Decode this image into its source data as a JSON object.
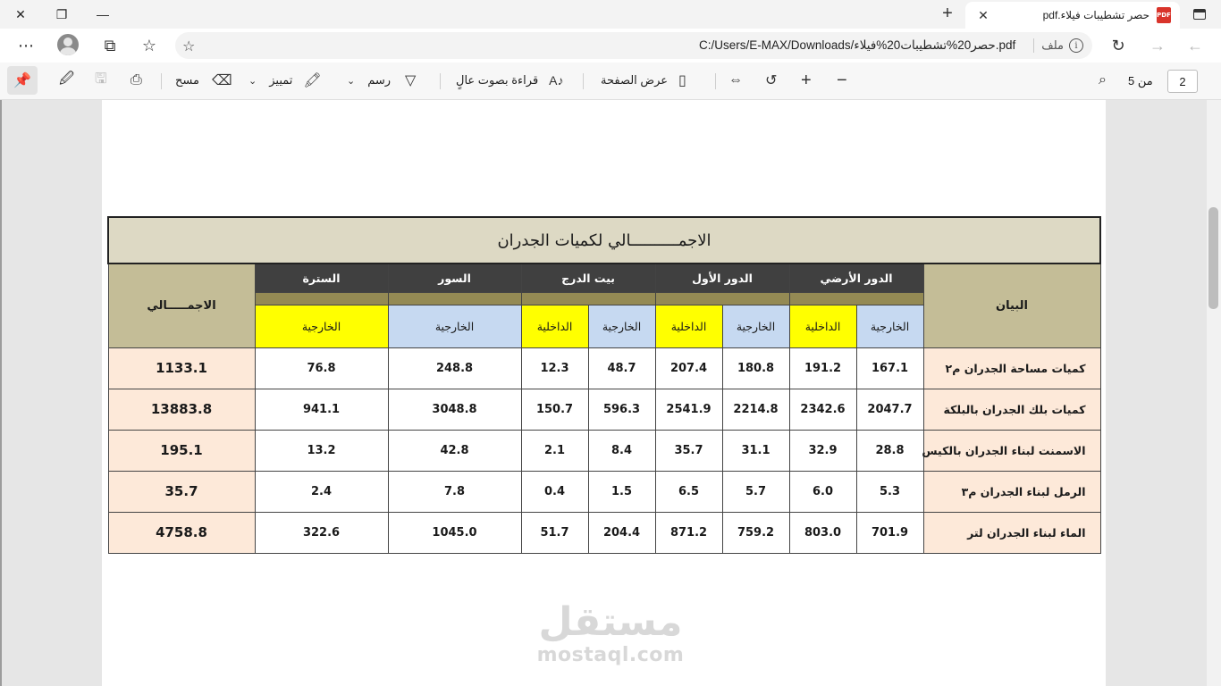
{
  "browser": {
    "tab_title": "حصر تشطيبات فيلاء.pdf",
    "pdf_icon_label": "PDF",
    "address_label": "ملف",
    "url": "C:/Users/E-MAX/Downloads/حصر20%تشطيبات20%فيلاء.pdf"
  },
  "pdf_toolbar": {
    "page_current": "2",
    "page_of": "من 5",
    "fit_page_label": "عرض الصفحة",
    "read_aloud_label": "قراءة بصوت عالٍ",
    "draw_label": "رسم",
    "highlight_label": "تمييز",
    "erase_label": "مسح"
  },
  "table": {
    "title": "الاجمــــــــــالي لكميات الجدران",
    "header_bayan": "البيان",
    "header_total": "الاجمـــــالي",
    "groups": [
      "الدور الأرضي",
      "الدور الأول",
      "بيت الدرج",
      "السور",
      "السترة"
    ],
    "sub_external": "الخارجية",
    "sub_internal": "الداخلية",
    "rows": [
      {
        "label": "كميات مساحة الجدران م٢",
        "values": [
          "167.1",
          "191.2",
          "180.8",
          "207.4",
          "48.7",
          "12.3",
          "248.8",
          "76.8"
        ],
        "total": "1133.1"
      },
      {
        "label": "كميات بلك الجدران  بالبلكة",
        "values": [
          "2047.7",
          "2342.6",
          "2214.8",
          "2541.9",
          "596.3",
          "150.7",
          "3048.8",
          "941.1"
        ],
        "total": "13883.8"
      },
      {
        "label": "الاسمنت لبناء الجدران بالكيس",
        "values": [
          "28.8",
          "32.9",
          "31.1",
          "35.7",
          "8.4",
          "2.1",
          "42.8",
          "13.2"
        ],
        "total": "195.1"
      },
      {
        "label": "الرمل لبناء الجدران م٣",
        "values": [
          "5.3",
          "6.0",
          "5.7",
          "6.5",
          "1.5",
          "0.4",
          "7.8",
          "2.4"
        ],
        "total": "35.7"
      },
      {
        "label": "الماء لبناء الجدران لتر",
        "values": [
          "701.9",
          "803.0",
          "759.2",
          "871.2",
          "204.4",
          "51.7",
          "1045.0",
          "322.6"
        ],
        "total": "4758.8"
      }
    ]
  },
  "watermark": {
    "arabic": "مستقل",
    "latin": "mostaql.com"
  },
  "colors": {
    "title_bg": "#ddd9c4",
    "group_header_bg": "#404040",
    "olive_band": "#948a54",
    "external_bg": "#c6d9f1",
    "internal_bg": "#ffff00",
    "label_bg": "#fde9d9"
  }
}
